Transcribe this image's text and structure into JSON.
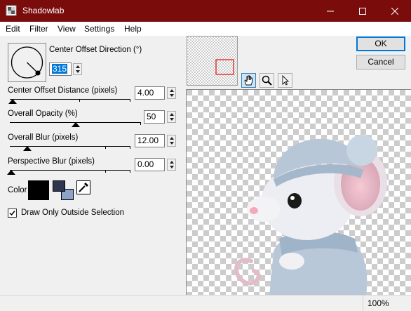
{
  "window": {
    "title": "Shadowlab",
    "minimize_icon": "minimize-icon",
    "maximize_icon": "maximize-icon",
    "close_icon": "close-icon"
  },
  "menu": [
    "Edit",
    "Filter",
    "View",
    "Settings",
    "Help"
  ],
  "direction": {
    "label": "Center Offset Direction (°)",
    "value": "315",
    "dial_icon": "direction-dial-icon"
  },
  "distance": {
    "label": "Center Offset Distance (pixels)",
    "value": "4.00"
  },
  "opacity": {
    "label": "Overall Opacity (%)",
    "value": "50"
  },
  "blur": {
    "label": "Overall Blur (pixels)",
    "value": "12.00"
  },
  "perspective": {
    "label": "Perspective Blur (pixels)",
    "value": "0.00"
  },
  "color": {
    "label": "Color",
    "swatch": "#000000",
    "pair_fg": "#2e3550",
    "pair_bg": "#8ca2c8",
    "picker_icon": "eyedropper-icon"
  },
  "draw_outside": {
    "label": "Draw Only Outside Selection",
    "checked": true
  },
  "buttons": {
    "ok": "OK",
    "cancel": "Cancel"
  },
  "tools": [
    "hand-icon",
    "zoom-icon",
    "pointer-icon"
  ],
  "status": {
    "zoom": "100%"
  },
  "colors": {
    "titlebar": "#7a0c0c",
    "accent": "#0078d7"
  }
}
